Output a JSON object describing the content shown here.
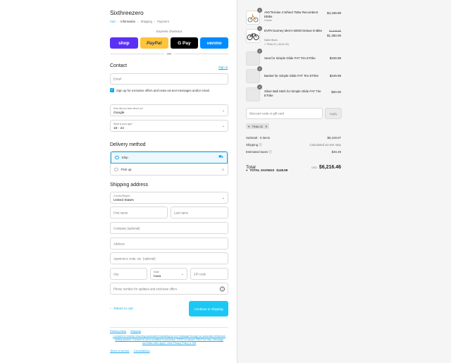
{
  "brand": "Sixthreezero",
  "breadcrumb": [
    "Cart",
    "Information",
    "Shipping",
    "Payment"
  ],
  "express_checkout": {
    "label": "Express checkout",
    "buttons": [
      "shop",
      "PayPal",
      "G Pay",
      "venmo"
    ],
    "or": "OR"
  },
  "contact": {
    "heading": "Contact",
    "sign_in": "Sign in",
    "email_placeholder": "Email",
    "offers_label": "Sign up for exclusive offers and news via text messages and/or email.",
    "offers_checked": true,
    "heard_label": "How did you hear about us?",
    "heard_value": "Google",
    "age_label": "What is your age?",
    "age_value": "18 - 24"
  },
  "delivery": {
    "heading": "Delivery method",
    "options": [
      {
        "label": "Ship",
        "selected": true,
        "icon": "truck-icon"
      },
      {
        "label": "Pick up",
        "selected": false,
        "icon": "store-icon"
      }
    ]
  },
  "shipping": {
    "heading": "Shipping address",
    "country_label": "Country/Region",
    "country_value": "United States",
    "first_name": "First name",
    "last_name": "Last name",
    "company": "Company (optional)",
    "address": "Address",
    "apartment": "Apartment, suite, etc. (optional)",
    "city": "City",
    "state_label": "State",
    "state_value": "Iowa",
    "zip": "ZIP code",
    "phone": "Phone number for updates and exclusive offers"
  },
  "actions": {
    "back": "Return to cart",
    "continue": "Continue to shipping"
  },
  "footer": {
    "links1": [
      "Refund policy",
      "Shipping"
    ],
    "note": "I consent to receive recurring automated marketing by text message through an automatic telephone dialing system. Consent is not a condition to purchase. STOP to cancel, HELP for help. Message and Data rates apply. View Privacy Policy & ToS",
    "links2": [
      "Terms of service",
      "Cancellations"
    ]
  },
  "cart": {
    "items": [
      {
        "qty": "1",
        "name": "ANYTernian 4 Wheel 750w Recumbent EBike",
        "sub": "Cream",
        "price": "$4,199.99",
        "old_price": ""
      },
      {
        "qty": "1",
        "name": "EVRYJourney Men's 500W Deluxe E-Bike",
        "sub": "Matte Black",
        "discount": "TRAIL22 (-$149.99)",
        "price": "$1,350.00",
        "old_price": "$1,499.99"
      },
      {
        "qty": "1",
        "name": "Seat for Simple Glide FAT Tire ETrike",
        "sub": "",
        "price": "$349.99",
        "old_price": ""
      },
      {
        "qty": "1",
        "name": "Basket for Simple Glide FAT Tire ETrike",
        "sub": "",
        "price": "$249.99",
        "old_price": ""
      },
      {
        "qty": "1",
        "name": "Silver Ball Hitch for Simple Glide FAT Tire ETrike",
        "sub": "",
        "price": "$20.00",
        "old_price": ""
      }
    ],
    "discount_placeholder": "Discount code or gift card",
    "apply": "Apply",
    "applied_code": "TRAIL22",
    "subtotal_label": "Subtotal · 5 items",
    "subtotal_value": "$6,169.97",
    "shipping_label": "Shipping",
    "shipping_value": "Calculated at next step",
    "taxes_label": "Estimated taxes",
    "taxes_value": "$46.49",
    "total_label": "Total",
    "currency": "USD",
    "total_value": "$6,216.46",
    "savings_label": "TOTAL SAVINGS",
    "savings_value": "$149.99"
  },
  "colors": {
    "accent": "#1aa8e6",
    "button": "#1ac8f5"
  }
}
